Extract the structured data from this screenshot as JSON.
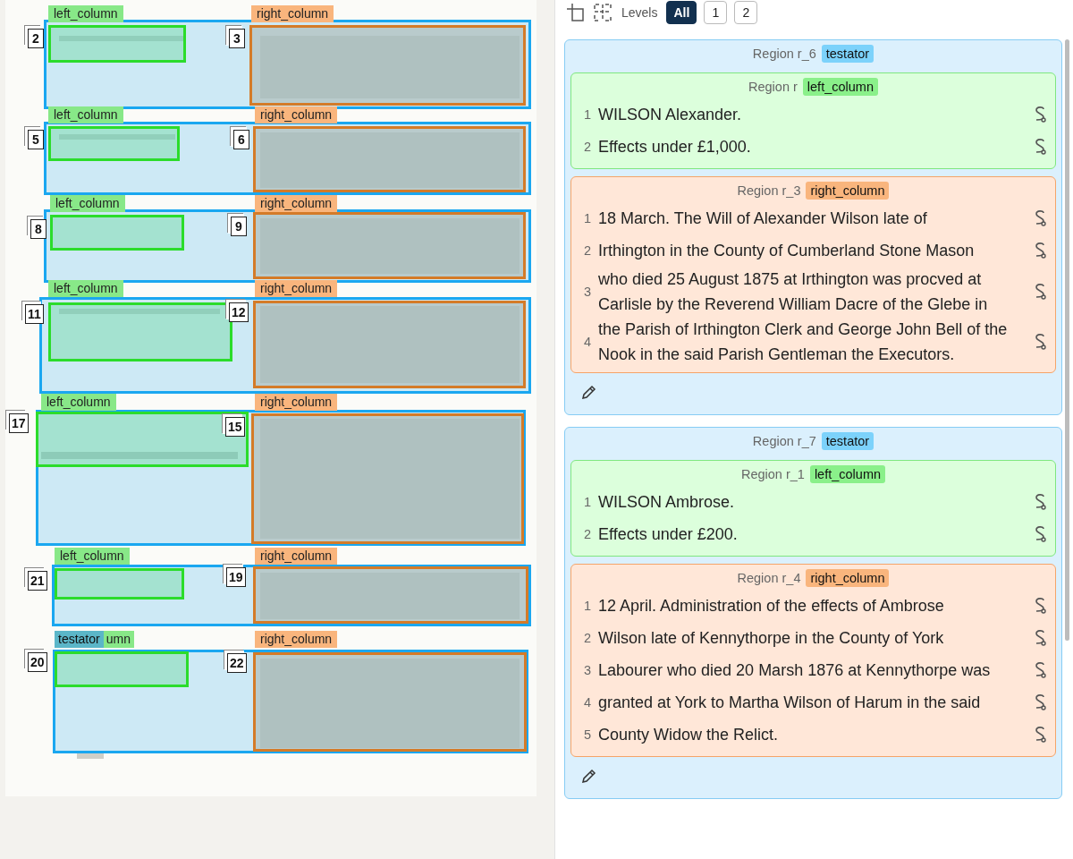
{
  "toolbar": {
    "levels_label": "Levels",
    "levels": [
      {
        "label": "All",
        "selected": true
      },
      {
        "label": "1",
        "selected": false
      },
      {
        "label": "2",
        "selected": false
      }
    ]
  },
  "scan": {
    "kind": "picture",
    "entries": [
      {
        "left_label": "left_column",
        "right_label": "right_column",
        "left_number": "2",
        "right_number": "3"
      },
      {
        "left_label": "left_column",
        "right_label": "right_column",
        "left_number": "5",
        "right_number": "6"
      },
      {
        "left_label": "left_column",
        "right_label": "right_column",
        "left_number": "8",
        "right_number": "9"
      },
      {
        "left_label": "left_column",
        "right_label": "right_column",
        "left_number": "11",
        "right_number": "12"
      },
      {
        "left_label": "left_column",
        "right_label": "right_column",
        "left_number": "17",
        "right_number": "15"
      },
      {
        "left_label": "left_column",
        "right_label": "right_column",
        "left_number": "21",
        "right_number": "19"
      },
      {
        "left_label": "umn",
        "right_label": "right_column",
        "left_number": "20",
        "right_number": "22",
        "testator_label": "testator"
      }
    ]
  },
  "regions": [
    {
      "title": "Region r_6",
      "tag": "testator",
      "children": [
        {
          "title": "Region r",
          "tag": "left_column",
          "kind": "left",
          "lines": [
            {
              "number": "1",
              "text": "WILSON Alexander."
            },
            {
              "number": "2",
              "text": "Effects under £1,000."
            }
          ]
        },
        {
          "title": "Region r_3",
          "tag": "right_column",
          "kind": "right",
          "lines": [
            {
              "number": "1",
              "text": "18 March. The Will of Alexander Wilson late of"
            },
            {
              "number": "2",
              "text": "Irthington in the County of Cumberland Stone Mason"
            },
            {
              "number": "3",
              "text": "who died 25 August 1875 at Irthington was procved at Carlisle by the Reverend William Dacre of the Glebe in"
            },
            {
              "number": "4",
              "text": "the Parish of Irthington Clerk and George John Bell of the Nook in the said Parish Gentleman the Executors."
            }
          ]
        }
      ]
    },
    {
      "title": "Region r_7",
      "tag": "testator",
      "children": [
        {
          "title": "Region r_1",
          "tag": "left_column",
          "kind": "left",
          "lines": [
            {
              "number": "1",
              "text": "WILSON Ambrose."
            },
            {
              "number": "2",
              "text": "Effects under £200."
            }
          ]
        },
        {
          "title": "Region r_4",
          "tag": "right_column",
          "kind": "right",
          "lines": [
            {
              "number": "1",
              "text": "12 April. Administration of the effects of Ambrose"
            },
            {
              "number": "2",
              "text": "Wilson late of Kennythorpe in the County of York"
            },
            {
              "number": "3",
              "text": "Labourer who died 20 Marsh 1876 at Kennythorpe was"
            },
            {
              "number": "4",
              "text": "granted at York to Martha Wilson of Harum in the said"
            },
            {
              "number": "5",
              "text": "County Widow the Relict."
            }
          ]
        }
      ]
    }
  ]
}
